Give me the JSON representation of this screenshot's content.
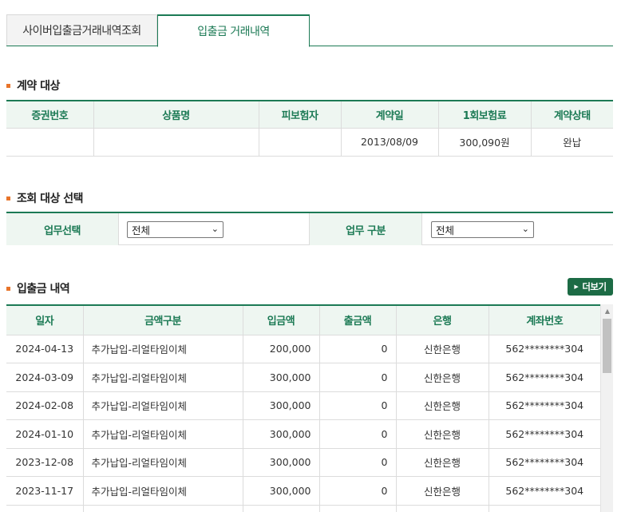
{
  "tabs": [
    {
      "label": "사이버입출금거래내역조회"
    },
    {
      "label": "입출금 거래내역"
    }
  ],
  "contract": {
    "title": "계약 대상",
    "headers": [
      "증권번호",
      "상품명",
      "피보험자",
      "계약일",
      "1회보험료",
      "계약상태"
    ],
    "row": [
      "",
      "",
      "",
      "2013/08/09",
      "300,090원",
      "완납"
    ]
  },
  "query": {
    "title": "조회 대상 선택",
    "business_label": "업무선택",
    "business_value": "전체",
    "category_label": "업무 구분",
    "category_value": "전체"
  },
  "history": {
    "title": "입출금 내역",
    "more_label": "더보기",
    "headers": [
      "일자",
      "금액구분",
      "입금액",
      "출금액",
      "은행",
      "계좌번호"
    ],
    "rows": [
      [
        "2024-04-13",
        "추가납입-리얼타임이체",
        "200,000",
        "0",
        "신한은행",
        "562********304"
      ],
      [
        "2024-03-09",
        "추가납입-리얼타임이체",
        "300,000",
        "0",
        "신한은행",
        "562********304"
      ],
      [
        "2024-02-08",
        "추가납입-리얼타임이체",
        "300,000",
        "0",
        "신한은행",
        "562********304"
      ],
      [
        "2024-01-10",
        "추가납입-리얼타임이체",
        "300,000",
        "0",
        "신한은행",
        "562********304"
      ],
      [
        "2023-12-08",
        "추가납입-리얼타임이체",
        "300,000",
        "0",
        "신한은행",
        "562********304"
      ],
      [
        "2023-11-17",
        "추가납입-리얼타임이체",
        "300,000",
        "0",
        "신한은행",
        "562********304"
      ],
      [
        "",
        "",
        "",
        "",
        "",
        ""
      ]
    ]
  },
  "colors": {
    "accent": "#1c7a55",
    "bullet": "#e8742a",
    "header_bg": "#eef6f1"
  }
}
